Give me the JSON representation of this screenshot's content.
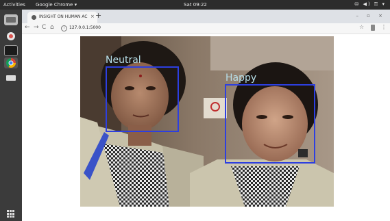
{
  "topbar": {
    "activities": "Activities",
    "app_menu": "Google Chrome ▾",
    "clock": "Sat 09:22",
    "tray": "⛁ ◀) ⚿ ▾"
  },
  "browser": {
    "tab_title": "INSIGHT ON HUMAN AC",
    "tab_close": "×",
    "new_tab": "+",
    "window_controls": "– ▫ ×",
    "nav": {
      "back": "←",
      "forward": "→",
      "reload": "C",
      "home": "⌂"
    },
    "url": "127.0.0.1:5000",
    "bookmark": "☆",
    "menu": "⋮"
  },
  "detections": [
    {
      "label": "Neutral"
    },
    {
      "label": "Happy"
    }
  ],
  "colors": {
    "box": "#2d3fe0",
    "label_text": "#b8e0ea"
  }
}
